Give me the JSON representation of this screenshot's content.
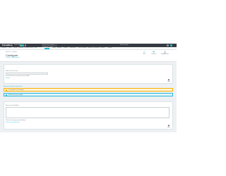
{
  "topbar": {
    "brand": "PrestaShop",
    "version": "1.7",
    "quick_access": "Quick Access",
    "search_placeholder": "Search (e.g.: product reference, custome",
    "shop_link": "View my shop",
    "colors": {
      "bar": "#363a41",
      "accent": "#25b9d7",
      "green": "#70b580",
      "orange": "#fab000"
    }
  },
  "tabs": [
    {
      "label": "Dashboard"
    },
    {
      "label": "Orders"
    },
    {
      "label": "Catalog"
    },
    {
      "label": "Customers"
    },
    {
      "label": "Customer Service"
    },
    {
      "label": "Stats"
    },
    {
      "label": "Modules"
    },
    {
      "label": "Design"
    },
    {
      "label": "Shipping"
    },
    {
      "label": "Payment"
    },
    {
      "label": "International"
    },
    {
      "label": "Shop Parameters"
    },
    {
      "label": "Advanced Parameters"
    },
    {
      "label": "Configure"
    },
    {
      "label": "Modules"
    }
  ],
  "header": {
    "breadcrumb": "Modules / Configure",
    "title": "Configure",
    "subtitle": "Translate · Manage hooks",
    "buttons": [
      {
        "label": "Back",
        "icon": "arrow-back-icon"
      },
      {
        "label": "Translate",
        "icon": "flag-icon"
      },
      {
        "label": "Manage hooks",
        "icon": "anchor-icon"
      }
    ]
  },
  "panel1": {
    "field_label": "Enter your license key",
    "hint": "Your license key can be found in your addons",
    "link": "Settings"
  },
  "section_title": "Advanced module configuration",
  "alerts": {
    "warning": "Your module is not activated.",
    "info": "Please check your settings."
  },
  "panel2": {
    "field_label": "Enter your email address",
    "hint": "Click here to verify your email address",
    "link": "Contact module developer"
  },
  "save_label": "Save"
}
